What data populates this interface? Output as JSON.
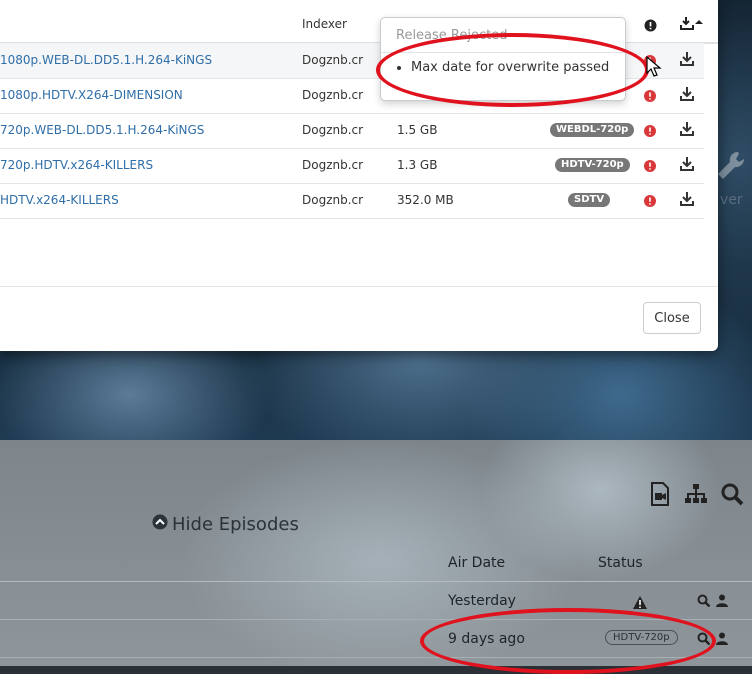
{
  "modal": {
    "columns": {
      "indexer": "Indexer"
    },
    "rows": [
      {
        "title": "1080p.WEB-DL.DD5.1.H.264-KiNGS",
        "indexer": "Dogznb.cr",
        "size": "",
        "quality": ""
      },
      {
        "title": "1080p.HDTV.X264-DIMENSION",
        "indexer": "Dogznb.cr",
        "size": "",
        "quality": ""
      },
      {
        "title": "720p.WEB-DL.DD5.1.H.264-KiNGS",
        "indexer": "Dogznb.cr",
        "size": "1.5 GB",
        "quality": "WEBDL-720p"
      },
      {
        "title": "720p.HDTV.x264-KILLERS",
        "indexer": "Dogznb.cr",
        "size": "1.3 GB",
        "quality": "HDTV-720p"
      },
      {
        "title": "HDTV.x264-KILLERS",
        "indexer": "Dogznb.cr",
        "size": "352.0 MB",
        "quality": "SDTV"
      }
    ],
    "close_label": "Close"
  },
  "popover": {
    "title": "Release Rejected",
    "reasons": [
      "Max date for overwrite passed"
    ]
  },
  "background_fragment": "ver",
  "episodes": {
    "hide_label": "Hide Episodes",
    "columns": {
      "air_date": "Air Date",
      "status": "Status"
    },
    "rows": [
      {
        "air_date": "Yesterday",
        "status_icon": "warning-icon",
        "status": ""
      },
      {
        "air_date": "9 days ago",
        "status_icon": "",
        "status": "HDTV-720p"
      }
    ]
  },
  "colors": {
    "link": "#2f6ea8",
    "reject": "#d9383a",
    "highlight": "#e0121e"
  }
}
